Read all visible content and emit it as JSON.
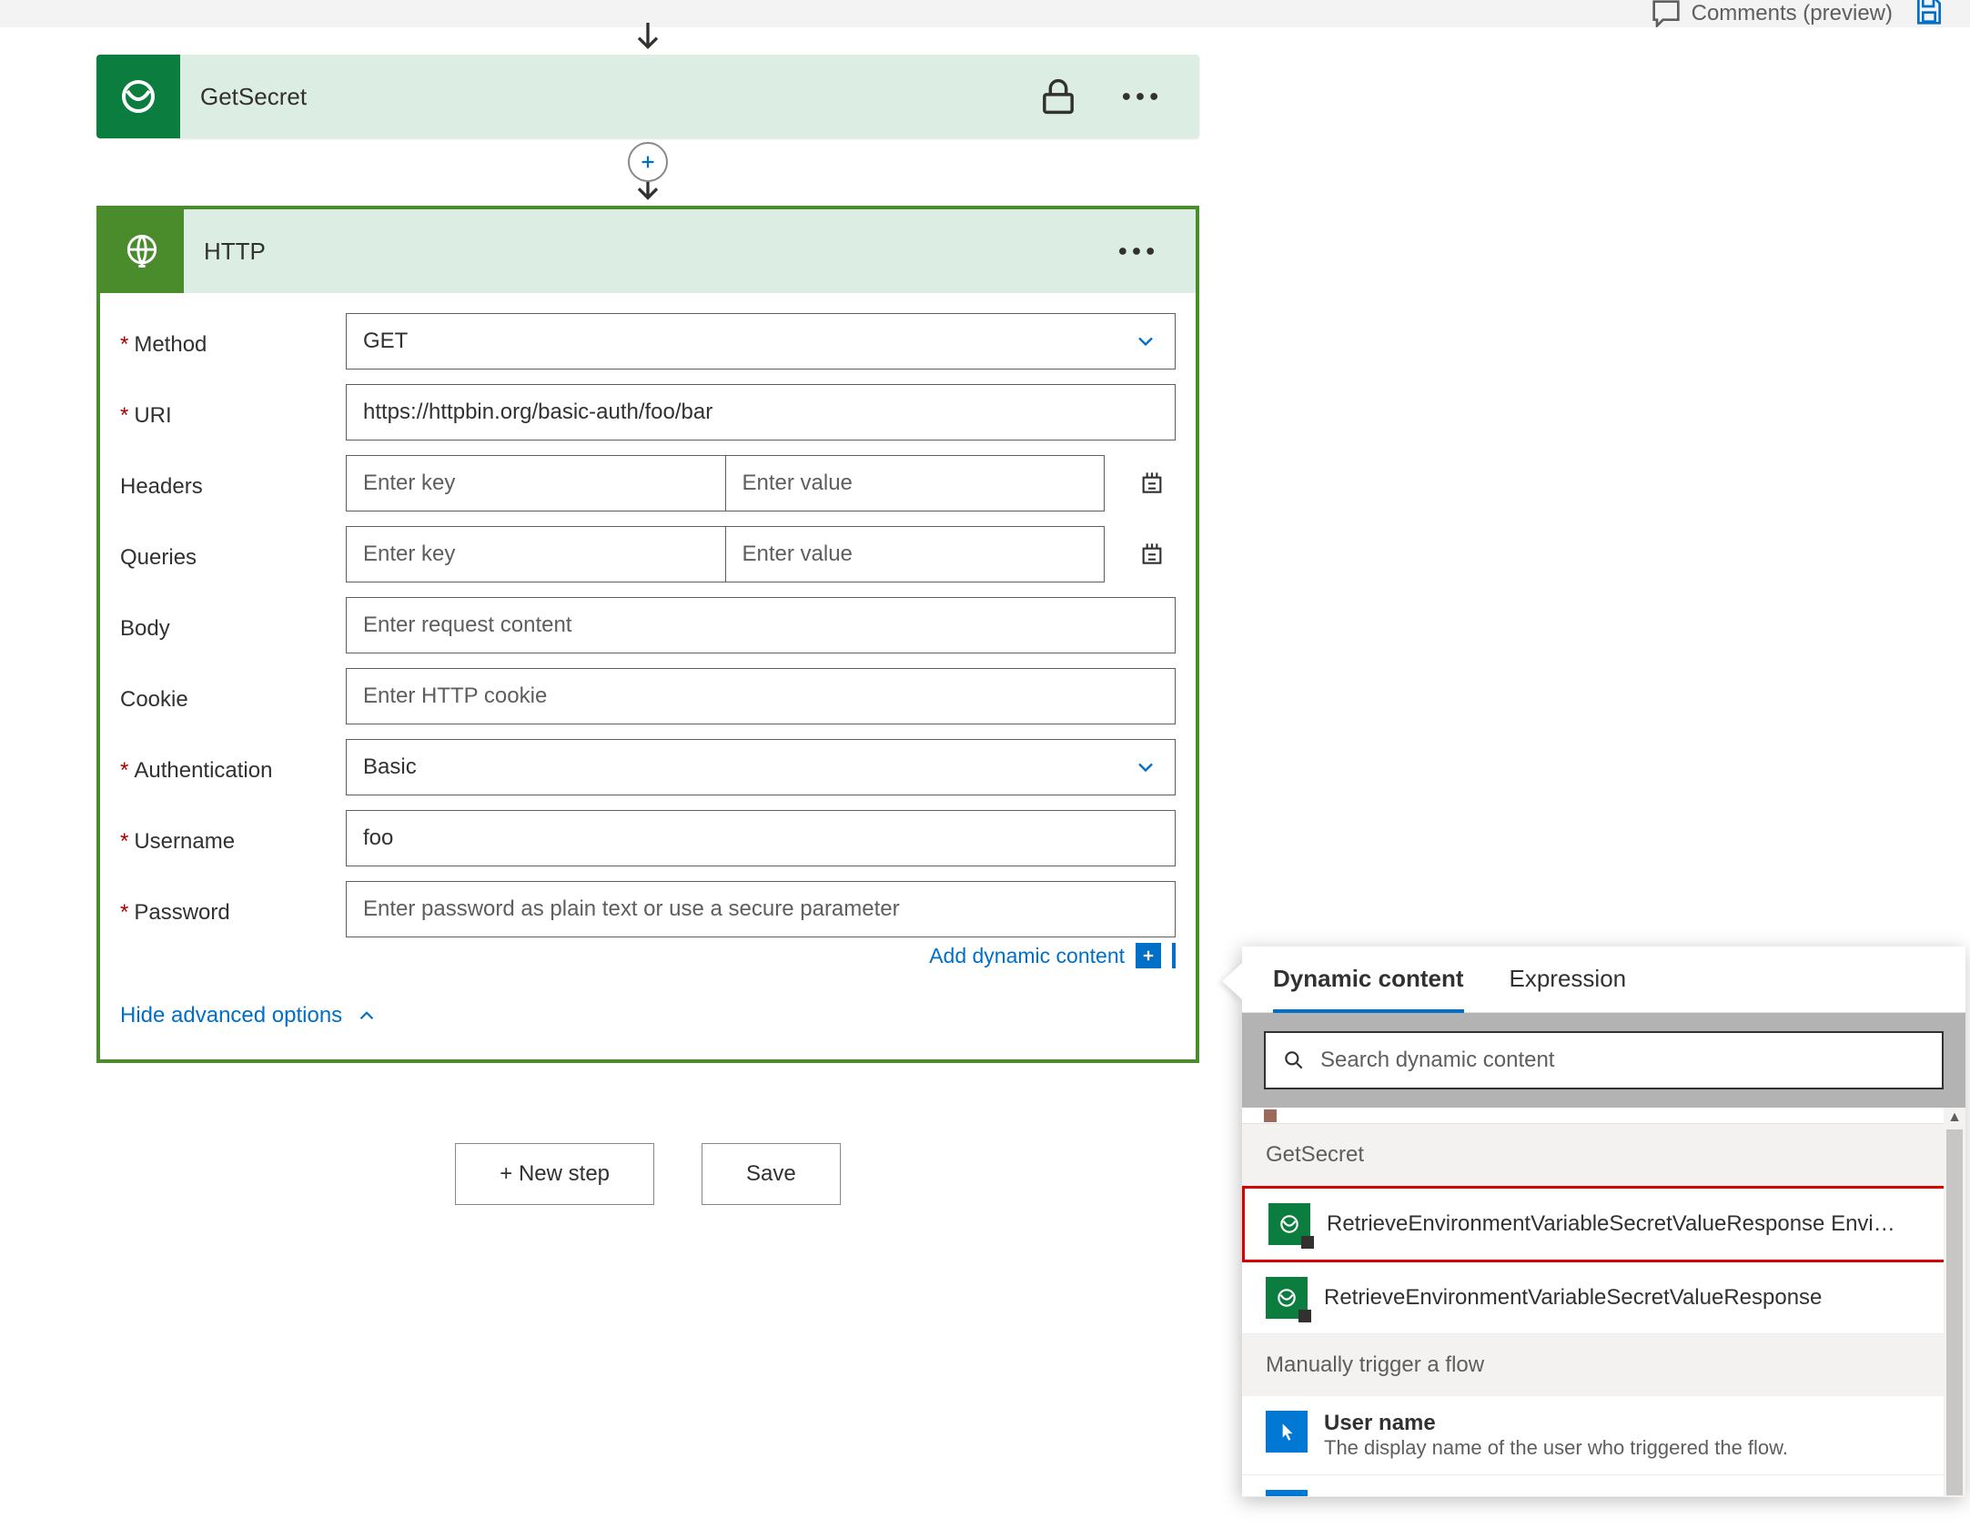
{
  "topbar": {
    "comments_label": "Comments (preview)"
  },
  "flow": {
    "get_secret": {
      "title": "GetSecret"
    },
    "http": {
      "title": "HTTP",
      "fields": {
        "method": {
          "label": "Method",
          "value": "GET"
        },
        "uri": {
          "label": "URI",
          "value": "https://httpbin.org/basic-auth/foo/bar"
        },
        "headers": {
          "label": "Headers",
          "key_placeholder": "Enter key",
          "value_placeholder": "Enter value"
        },
        "queries": {
          "label": "Queries",
          "key_placeholder": "Enter key",
          "value_placeholder": "Enter value"
        },
        "body": {
          "label": "Body",
          "placeholder": "Enter request content"
        },
        "cookie": {
          "label": "Cookie",
          "placeholder": "Enter HTTP cookie"
        },
        "authentication": {
          "label": "Authentication",
          "value": "Basic"
        },
        "username": {
          "label": "Username",
          "value": "foo"
        },
        "password": {
          "label": "Password",
          "placeholder": "Enter password as plain text or use a secure parameter"
        }
      },
      "add_dynamic": "Add dynamic content",
      "hide_advanced": "Hide advanced options"
    },
    "actions": {
      "new_step": "+ New step",
      "save": "Save"
    }
  },
  "dynamic_panel": {
    "tabs": {
      "dynamic": "Dynamic content",
      "expression": "Expression"
    },
    "search_placeholder": "Search dynamic content",
    "sections": {
      "get_secret": {
        "title": "GetSecret",
        "items": [
          {
            "label": "RetrieveEnvironmentVariableSecretValueResponse Envi…"
          },
          {
            "label": "RetrieveEnvironmentVariableSecretValueResponse"
          }
        ]
      },
      "manual": {
        "title": "Manually trigger a flow",
        "items": [
          {
            "label": "User name",
            "sub": "The display name of the user who triggered the flow."
          }
        ]
      }
    }
  }
}
